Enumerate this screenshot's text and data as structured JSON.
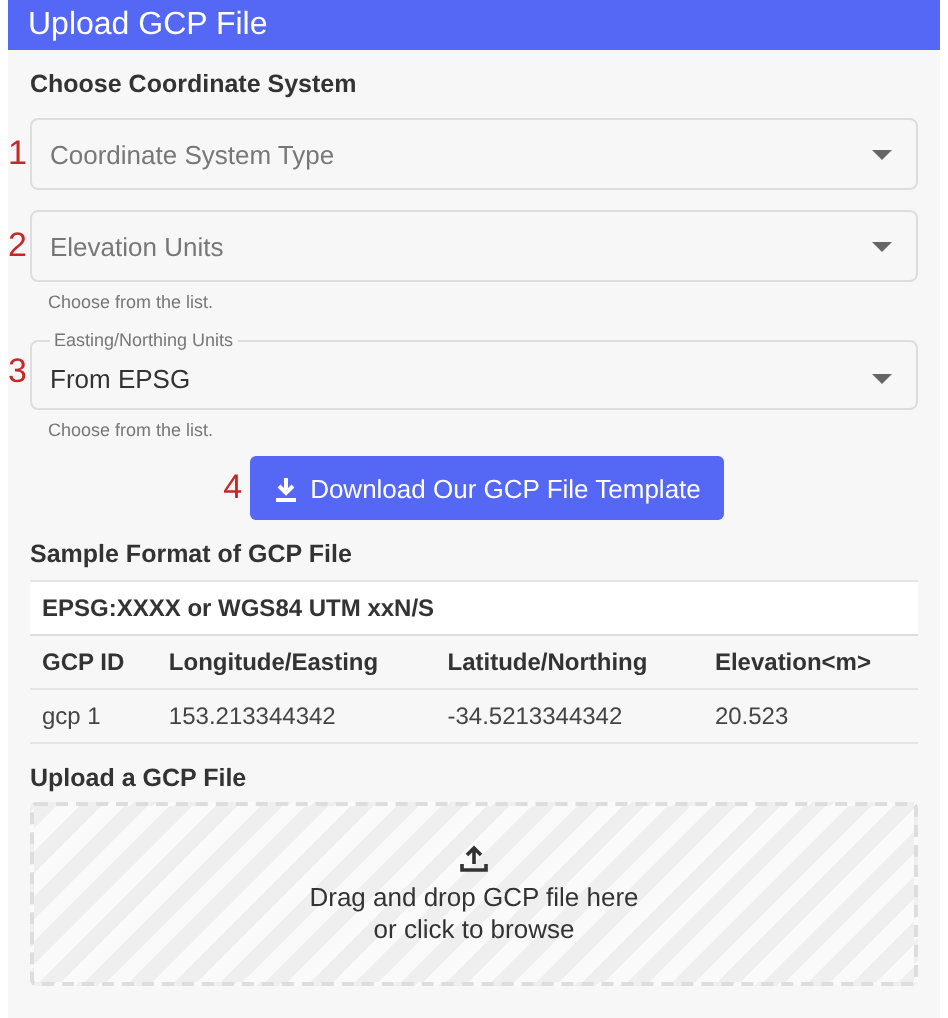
{
  "header": {
    "title": "Upload GCP File"
  },
  "coordinate_section": {
    "heading": "Choose Coordinate System",
    "selects": [
      {
        "marker": "1",
        "placeholder": "Coordinate System Type"
      },
      {
        "marker": "2",
        "placeholder": "Elevation Units",
        "helper": "Choose from the list."
      },
      {
        "marker": "3",
        "label": "Easting/Northing Units",
        "value": "From EPSG",
        "helper": "Choose from the list."
      }
    ]
  },
  "download": {
    "marker": "4",
    "label": "Download Our GCP File Template"
  },
  "sample": {
    "heading": "Sample Format of GCP File",
    "caption": "EPSG:XXXX or WGS84 UTM xxN/S",
    "columns": [
      "GCP ID",
      "Longitude/Easting",
      "Latitude/Northing",
      "Elevation<m>"
    ],
    "rows": [
      [
        "gcp 1",
        "153.213344342",
        "-34.5213344342",
        "20.523"
      ]
    ]
  },
  "upload": {
    "heading": "Upload a GCP File",
    "lines": [
      "Drag and drop GCP file here",
      "or click to browse"
    ]
  }
}
